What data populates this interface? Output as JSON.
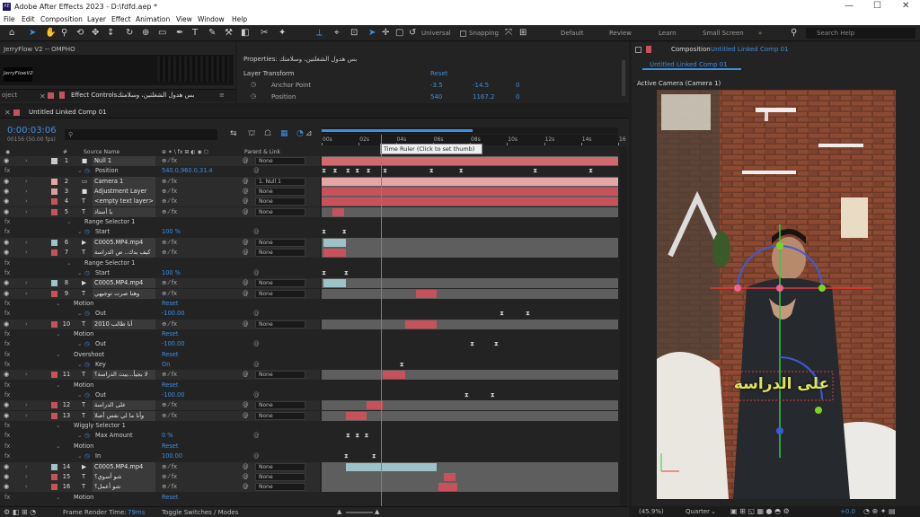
{
  "window": {
    "app_title": "Adobe After Effects 2023 - D:\\fdfd.aep *",
    "icon": "AE"
  },
  "menu": [
    "File",
    "Edit",
    "Composition",
    "Layer",
    "Effect",
    "Animation",
    "View",
    "Window",
    "Help"
  ],
  "toolbar": {
    "universal": "Universal",
    "snapping": "Snapping",
    "workspaces": [
      "Default",
      "Review",
      "Learn",
      "Small Screen"
    ],
    "search_placeholder": "Search Help"
  },
  "left_panel": {
    "title": "JerryFlow V2 -- OMPHO",
    "thumb_label": "JerryFlowV2",
    "tab_project": "oject",
    "tab_effects": "Effect Controls",
    "effects_layer": "بس هدول الشغلتين، وسلامتك"
  },
  "properties": {
    "title": "Properties: بس هدول الشغلتين، وسلامتك",
    "group": "Layer Transform",
    "reset": "Reset",
    "anchor_label": "Anchor Point",
    "anchor_x": "-3.5",
    "anchor_y": "-14.5",
    "anchor_z": "0",
    "position_label": "Position",
    "position_x": "540",
    "position_y": "1167.2",
    "position_z": "0"
  },
  "composition": {
    "header_prefix": "Composition",
    "header_name": "Untitled Linked Comp 01",
    "tab": "Untitled Linked Comp 01",
    "active_camera": "Active Camera (Camera 1)",
    "overlay_text": "على الدراسة",
    "zoom": "(45.9%)",
    "quality": "Quarter",
    "exposure": "+0.0"
  },
  "timeline": {
    "tab": "Untitled Linked Comp 01",
    "timecode": "0:00:03:06",
    "frames": "00156 (50.00 fps)",
    "col_source": "Source Name",
    "col_parent": "Parent & Link",
    "tooltip": "Time Ruler (Click to set thumb)",
    "ruler": [
      "00s",
      "02s",
      "04s",
      "06s",
      "08s",
      "10s",
      "12s",
      "14s",
      "16"
    ],
    "playhead_sec": 3.2
  },
  "rows": [
    {
      "t": "layer",
      "n": "1",
      "name": "Null 1",
      "c": "#c9c9c9",
      "parent": "None",
      "ic": "■",
      "bar": [
        0,
        16
      ],
      "bc": "#d06a6f"
    },
    {
      "t": "prop",
      "ind": 3,
      "name": "Position",
      "val": "540.0,960.0,31.4",
      "kf": [
        0.1,
        0.7,
        1.4,
        1.9,
        2.5,
        3.4,
        5.9,
        7.5,
        11.5,
        14.5
      ]
    },
    {
      "t": "layer",
      "n": "2",
      "name": "Camera 1",
      "c": "#e8a5a8",
      "parent": "1. Null 1",
      "ic": "▭",
      "bar": [
        0,
        16
      ],
      "bc": "#e8a5a8"
    },
    {
      "t": "layer",
      "n": "3",
      "name": "Adjustment Layer",
      "c": "#d99da0",
      "parent": "None",
      "ic": "■",
      "bar": [
        0,
        16
      ],
      "bc": "#c8525c"
    },
    {
      "t": "layer",
      "n": "4",
      "name": "<empty text layer>",
      "c": "#c8525c",
      "parent": "None",
      "ic": "T",
      "bar": [
        0,
        16
      ],
      "bc": "#c8525c"
    },
    {
      "t": "layer",
      "n": "5",
      "name": "يا أستاذ",
      "c": "#c8525c",
      "parent": "None",
      "ic": "T",
      "bar": [
        0.6,
        1.2
      ],
      "bc": "#c8525c"
    },
    {
      "t": "prop",
      "ind": 2,
      "name": "Range Selector 1"
    },
    {
      "t": "prop",
      "ind": 3,
      "name": "Start",
      "val": "100 %",
      "kf": [
        0.1,
        1.2
      ]
    },
    {
      "t": "layer",
      "n": "6",
      "name": "C0005.MP4.mp4",
      "c": "#9bc3c8",
      "parent": "None",
      "ic": "▶",
      "bar": [
        0.1,
        1.3
      ],
      "bc": "#9bc3c8"
    },
    {
      "t": "layer",
      "n": "7",
      "name": "كيف بدك.. ض الدراسة",
      "c": "#c8525c",
      "parent": "None",
      "ic": "T",
      "bar": [
        0.1,
        1.3
      ],
      "bc": "#c8525c"
    },
    {
      "t": "prop",
      "ind": 2,
      "name": "Range Selector 1"
    },
    {
      "t": "prop",
      "ind": 3,
      "name": "Start",
      "val": "100 %",
      "kf": [
        0.1,
        1.3
      ]
    },
    {
      "t": "layer",
      "n": "8",
      "name": "C0005.MP4.mp4",
      "c": "#9bc3c8",
      "parent": "None",
      "ic": "▶",
      "bar": [
        0.1,
        1.3
      ],
      "bc": "#9bc3c8"
    },
    {
      "t": "layer",
      "n": "9",
      "name": "وهنا صرت توجيهي",
      "c": "#c8525c",
      "parent": "None",
      "ic": "T",
      "bar": [
        5.1,
        6.2
      ],
      "bc": "#c8525c"
    },
    {
      "t": "prop",
      "ind": 1,
      "name": "Motion",
      "val": "Reset"
    },
    {
      "t": "prop",
      "ind": 3,
      "name": "Out",
      "val": "-100.00",
      "kf": [
        9.7,
        11.1
      ]
    },
    {
      "t": "layer",
      "n": "10",
      "name": "أنا طالب 2010",
      "c": "#c8525c",
      "parent": "None",
      "ic": "T",
      "bar": [
        4.5,
        6.2
      ],
      "bc": "#c8525c"
    },
    {
      "t": "prop",
      "ind": 1,
      "name": "Motion",
      "val": "Reset"
    },
    {
      "t": "prop",
      "ind": 3,
      "name": "Out",
      "val": "-100.00",
      "kf": [
        8.1,
        9.4
      ]
    },
    {
      "t": "prop",
      "ind": 1,
      "name": "Overshoot",
      "val": "Reset"
    },
    {
      "t": "prop",
      "ind": 3,
      "name": "Key",
      "val": "On",
      "kf": [
        4.3
      ]
    },
    {
      "t": "layer",
      "n": "11",
      "name": "لا بجيأ...بيت الدراسة؟",
      "c": "#c8525c",
      "parent": "None",
      "ic": "T",
      "bar": [
        3.3,
        4.5
      ],
      "bc": "#c8525c"
    },
    {
      "t": "prop",
      "ind": 1,
      "name": "Motion",
      "val": "Reset"
    },
    {
      "t": "prop",
      "ind": 3,
      "name": "Out",
      "val": "-100.00",
      "kf": [
        7.8,
        9.2
      ]
    },
    {
      "t": "layer",
      "n": "12",
      "name": "على الدراسة",
      "c": "#c8525c",
      "parent": "None",
      "ic": "T",
      "bar": [
        2.4,
        3.3
      ],
      "bc": "#c8525c"
    },
    {
      "t": "layer",
      "n": "13",
      "name": "وأنا ما لي نفس أصلا",
      "c": "#c8525c",
      "parent": "None",
      "ic": "T",
      "bar": [
        1.3,
        2.4
      ],
      "bc": "#c8525c"
    },
    {
      "t": "prop",
      "ind": 1,
      "name": "Wiggly Selector 1"
    },
    {
      "t": "prop",
      "ind": 3,
      "name": "Max Amount",
      "val": "0 %",
      "kf": [
        1.4,
        1.9,
        2.4
      ]
    },
    {
      "t": "prop",
      "ind": 1,
      "name": "Motion",
      "val": "Reset"
    },
    {
      "t": "prop",
      "ind": 3,
      "name": "In",
      "val": "100.00",
      "kf": [
        1.3,
        2.8
      ]
    },
    {
      "t": "layer",
      "n": "14",
      "name": "C0005.MP4.mp4",
      "c": "#9bc3c8",
      "parent": "None",
      "ic": "▶",
      "bar": [
        1.3,
        6.2
      ],
      "bc": "#9bc3c8"
    },
    {
      "t": "layer",
      "n": "15",
      "name": "شو أسوي؟",
      "c": "#c8525c",
      "parent": "None",
      "ic": "T",
      "bar": [
        6.6,
        7.2
      ],
      "bc": "#c8525c"
    },
    {
      "t": "layer",
      "n": "16",
      "name": "شو أعمل؟",
      "c": "#c8525c",
      "parent": "None",
      "ic": "T",
      "bar": [
        6.3,
        7.3
      ],
      "bc": "#c8525c"
    },
    {
      "t": "prop",
      "ind": 1,
      "name": "Motion",
      "val": "Reset"
    }
  ],
  "status": {
    "render_label": "Frame Render Time:",
    "render_value": "79ms",
    "toggle": "Toggle Switches / Modes"
  }
}
